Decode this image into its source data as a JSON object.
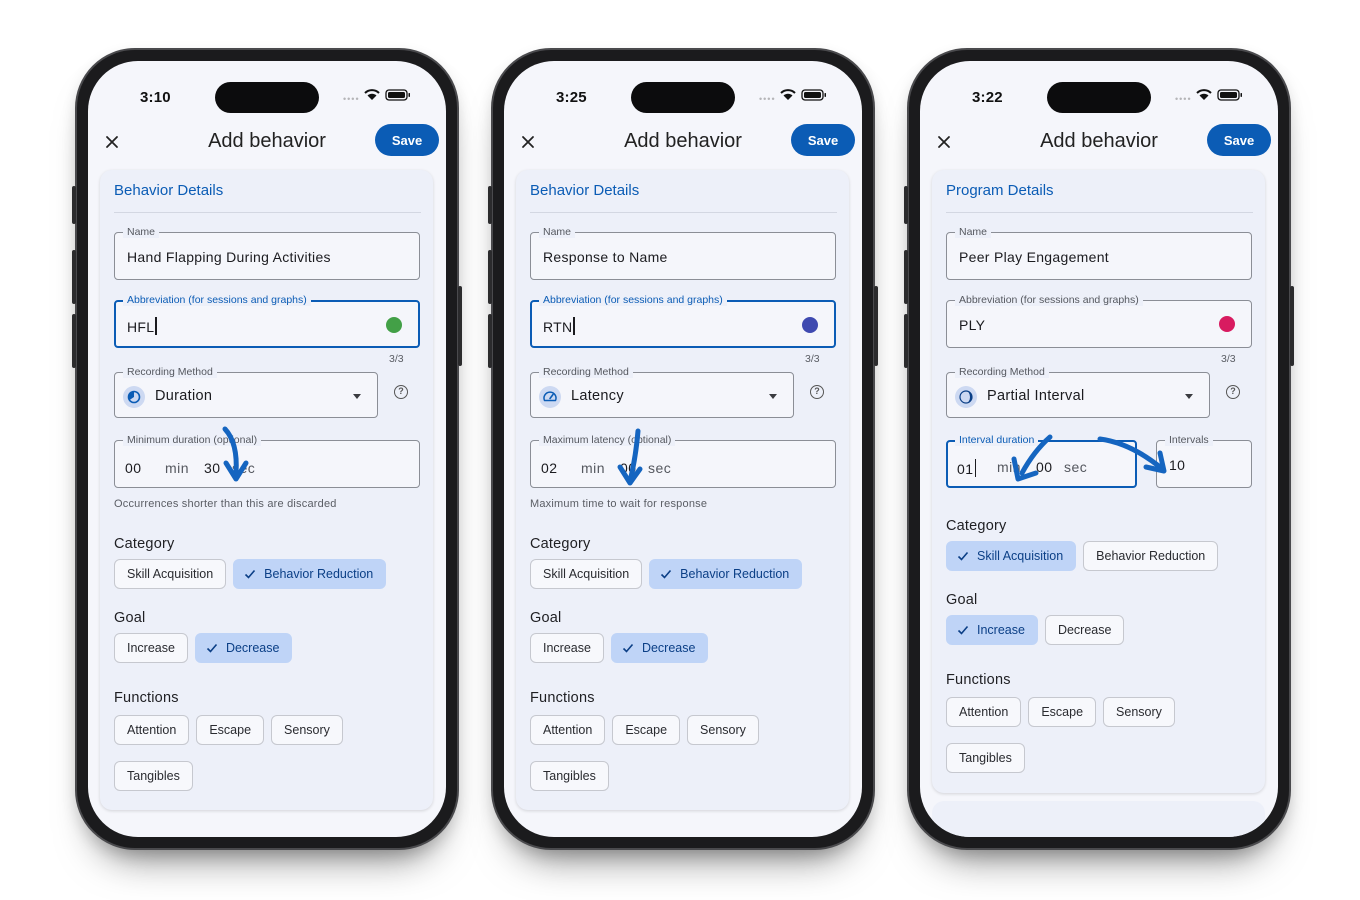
{
  "phones": [
    {
      "status_time": "3:10",
      "title": "Add behavior",
      "save_label": "Save",
      "section_title": "Behavior Details",
      "name": {
        "label": "Name",
        "value": "Hand Flapping During Activities"
      },
      "abbr": {
        "label": "Abbreviation (for sessions and graphs)",
        "value": "HFL",
        "counter": "3/3",
        "color": "#43a047"
      },
      "method": {
        "label": "Recording Method",
        "value": "Duration",
        "icon": "duration-icon"
      },
      "time_field": {
        "label": "Minimum duration (optional)",
        "min_value": "00",
        "min_unit": "min",
        "sec_value": "30",
        "sec_unit": "sec"
      },
      "helper": "Occurrences shorter than this are discarded",
      "category": {
        "label": "Category",
        "options": [
          {
            "label": "Skill Acquisition",
            "selected": false
          },
          {
            "label": "Behavior Reduction",
            "selected": true
          }
        ]
      },
      "goal": {
        "label": "Goal",
        "options": [
          {
            "label": "Increase",
            "selected": false
          },
          {
            "label": "Decrease",
            "selected": true
          }
        ]
      },
      "functions": {
        "label": "Functions",
        "row1": [
          "Attention",
          "Escape",
          "Sensory"
        ],
        "row2": [
          "Tangibles"
        ]
      }
    },
    {
      "status_time": "3:25",
      "title": "Add behavior",
      "save_label": "Save",
      "section_title": "Behavior Details",
      "name": {
        "label": "Name",
        "value": "Response to Name"
      },
      "abbr": {
        "label": "Abbreviation (for sessions and graphs)",
        "value": "RTN",
        "counter": "3/3",
        "color": "#3f4ab0"
      },
      "method": {
        "label": "Recording Method",
        "value": "Latency",
        "icon": "speedometer-icon"
      },
      "time_field": {
        "label": "Maximum latency (optional)",
        "min_value": "02",
        "min_unit": "min",
        "sec_value": "00",
        "sec_unit": "sec"
      },
      "helper": "Maximum time to wait for response",
      "category": {
        "label": "Category",
        "options": [
          {
            "label": "Skill Acquisition",
            "selected": false
          },
          {
            "label": "Behavior Reduction",
            "selected": true
          }
        ]
      },
      "goal": {
        "label": "Goal",
        "options": [
          {
            "label": "Increase",
            "selected": false
          },
          {
            "label": "Decrease",
            "selected": true
          }
        ]
      },
      "functions": {
        "label": "Functions",
        "row1": [
          "Attention",
          "Escape",
          "Sensory"
        ],
        "row2": [
          "Tangibles"
        ]
      }
    },
    {
      "status_time": "3:22",
      "title": "Add behavior",
      "save_label": "Save",
      "section_title": "Program Details",
      "name": {
        "label": "Name",
        "value": "Peer Play Engagement"
      },
      "abbr": {
        "label": "Abbreviation (for sessions and graphs)",
        "value": "PLY",
        "counter": "3/3",
        "color": "#d81b60"
      },
      "method": {
        "label": "Recording Method",
        "value": "Partial Interval",
        "icon": "half-moon-icon"
      },
      "time_field": {
        "label": "Interval duration",
        "min_value": "01",
        "min_unit": "min",
        "sec_value": "00",
        "sec_unit": "sec"
      },
      "intervals": {
        "label": "Intervals",
        "value": "10"
      },
      "category": {
        "label": "Category",
        "options": [
          {
            "label": "Skill Acquisition",
            "selected": true
          },
          {
            "label": "Behavior Reduction",
            "selected": false
          }
        ]
      },
      "goal": {
        "label": "Goal",
        "options": [
          {
            "label": "Increase",
            "selected": true
          },
          {
            "label": "Decrease",
            "selected": false
          }
        ]
      },
      "functions": {
        "label": "Functions",
        "row1": [
          "Attention",
          "Escape",
          "Sensory"
        ],
        "row2": [
          "Tangibles"
        ]
      }
    }
  ],
  "colors": {
    "accent": "#0b5cb5",
    "chip_selected": "#bfd4f7",
    "annotation_arrow": "#1565c0"
  }
}
